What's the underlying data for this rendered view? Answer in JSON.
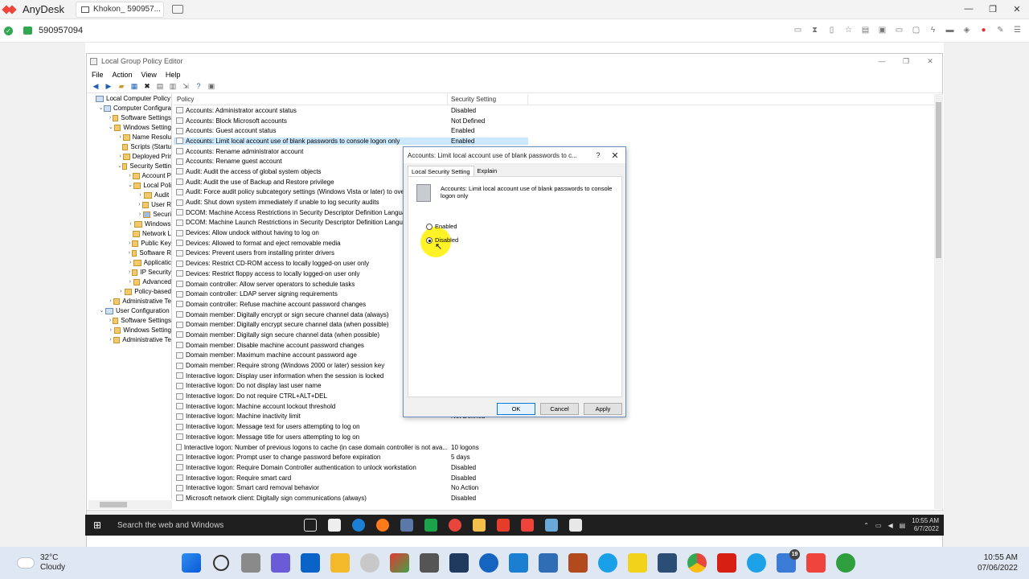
{
  "anydesk": {
    "app_name": "AnyDesk",
    "tab_label": "Khokon_ 590957...",
    "remote_id": "590957094",
    "accent": "#ef443b"
  },
  "gpe": {
    "title": "Local Group Policy Editor",
    "menu": [
      "File",
      "Action",
      "View",
      "Help"
    ],
    "tree": [
      {
        "label": "Local Computer Policy",
        "indent": 0,
        "tw": "",
        "icon": "pc"
      },
      {
        "label": "Computer Configura",
        "indent": 1,
        "tw": "⌄",
        "icon": "pc"
      },
      {
        "label": "Software Settings",
        "indent": 2,
        "tw": "›",
        "icon": "folder"
      },
      {
        "label": "Windows Setting",
        "indent": 2,
        "tw": "⌄",
        "icon": "folder"
      },
      {
        "label": "Name Resolu",
        "indent": 3,
        "tw": "›",
        "icon": "folder"
      },
      {
        "label": "Scripts (Startu",
        "indent": 3,
        "tw": "",
        "icon": "folder"
      },
      {
        "label": "Deployed Prir",
        "indent": 3,
        "tw": "›",
        "icon": "folder"
      },
      {
        "label": "Security Settin",
        "indent": 3,
        "tw": "⌄",
        "icon": "folder"
      },
      {
        "label": "Account P",
        "indent": 4,
        "tw": "›",
        "icon": "folder"
      },
      {
        "label": "Local Poli",
        "indent": 4,
        "tw": "⌄",
        "icon": "folder"
      },
      {
        "label": "Audit",
        "indent": 5,
        "tw": "›",
        "icon": "folder"
      },
      {
        "label": "User R",
        "indent": 5,
        "tw": "›",
        "icon": "folder"
      },
      {
        "label": "Securi",
        "indent": 5,
        "tw": "›",
        "icon": "folder-selected"
      },
      {
        "label": "Windows",
        "indent": 4,
        "tw": "›",
        "icon": "folder"
      },
      {
        "label": "Network L",
        "indent": 4,
        "tw": "",
        "icon": "folder"
      },
      {
        "label": "Public Key",
        "indent": 4,
        "tw": "›",
        "icon": "folder"
      },
      {
        "label": "Software R",
        "indent": 4,
        "tw": "›",
        "icon": "folder"
      },
      {
        "label": "Applicatic",
        "indent": 4,
        "tw": "›",
        "icon": "folder"
      },
      {
        "label": "IP Security",
        "indent": 4,
        "tw": "›",
        "icon": "folder"
      },
      {
        "label": "Advanced",
        "indent": 4,
        "tw": "›",
        "icon": "folder"
      },
      {
        "label": "Policy-based",
        "indent": 3,
        "tw": "›",
        "icon": "folder"
      },
      {
        "label": "Administrative Te",
        "indent": 2,
        "tw": "›",
        "icon": "folder"
      },
      {
        "label": "User Configuration",
        "indent": 1,
        "tw": "⌄",
        "icon": "pc"
      },
      {
        "label": "Software Settings",
        "indent": 2,
        "tw": "›",
        "icon": "folder"
      },
      {
        "label": "Windows Setting",
        "indent": 2,
        "tw": "›",
        "icon": "folder"
      },
      {
        "label": "Administrative Te",
        "indent": 2,
        "tw": "›",
        "icon": "folder"
      }
    ],
    "columns": {
      "policy": "Policy",
      "setting": "Security Setting"
    },
    "rows": [
      {
        "policy": "Accounts: Administrator account status",
        "setting": "Disabled"
      },
      {
        "policy": "Accounts: Block Microsoft accounts",
        "setting": "Not Defined"
      },
      {
        "policy": "Accounts: Guest account status",
        "setting": "Enabled"
      },
      {
        "policy": "Accounts: Limit local account use of blank passwords to console logon only",
        "setting": "Enabled",
        "selected": true
      },
      {
        "policy": "Accounts: Rename administrator account",
        "setting": ""
      },
      {
        "policy": "Accounts: Rename guest account",
        "setting": ""
      },
      {
        "policy": "Audit: Audit the access of global system objects",
        "setting": ""
      },
      {
        "policy": "Audit: Audit the use of Backup and Restore privilege",
        "setting": ""
      },
      {
        "policy": "Audit: Force audit policy subcategory settings (Windows Vista or later) to overr",
        "setting": ""
      },
      {
        "policy": "Audit: Shut down system immediately if unable to log security audits",
        "setting": ""
      },
      {
        "policy": "DCOM: Machine Access Restrictions in Security Descriptor Definition Languag",
        "setting": ""
      },
      {
        "policy": "DCOM: Machine Launch Restrictions in Security Descriptor Definition Langua",
        "setting": ""
      },
      {
        "policy": "Devices: Allow undock without having to log on",
        "setting": ""
      },
      {
        "policy": "Devices: Allowed to format and eject removable media",
        "setting": ""
      },
      {
        "policy": "Devices: Prevent users from installing printer drivers",
        "setting": ""
      },
      {
        "policy": "Devices: Restrict CD-ROM access to locally logged-on user only",
        "setting": ""
      },
      {
        "policy": "Devices: Restrict floppy access to locally logged-on user only",
        "setting": ""
      },
      {
        "policy": "Domain controller: Allow server operators to schedule tasks",
        "setting": ""
      },
      {
        "policy": "Domain controller: LDAP server signing requirements",
        "setting": ""
      },
      {
        "policy": "Domain controller: Refuse machine account password changes",
        "setting": ""
      },
      {
        "policy": "Domain member: Digitally encrypt or sign secure channel data (always)",
        "setting": ""
      },
      {
        "policy": "Domain member: Digitally encrypt secure channel data (when possible)",
        "setting": ""
      },
      {
        "policy": "Domain member: Digitally sign secure channel data (when possible)",
        "setting": ""
      },
      {
        "policy": "Domain member: Disable machine account password changes",
        "setting": ""
      },
      {
        "policy": "Domain member: Maximum machine account password age",
        "setting": ""
      },
      {
        "policy": "Domain member: Require strong (Windows 2000 or later) session key",
        "setting": ""
      },
      {
        "policy": "Interactive logon: Display user information when the session is locked",
        "setting": ""
      },
      {
        "policy": "Interactive logon: Do not display last user name",
        "setting": ""
      },
      {
        "policy": "Interactive logon: Do not require CTRL+ALT+DEL",
        "setting": ""
      },
      {
        "policy": "Interactive logon: Machine account lockout threshold",
        "setting": ""
      },
      {
        "policy": "Interactive logon: Machine inactivity limit",
        "setting": "Not Defined"
      },
      {
        "policy": "Interactive logon: Message text for users attempting to log on",
        "setting": ""
      },
      {
        "policy": "Interactive logon: Message title for users attempting to log on",
        "setting": ""
      },
      {
        "policy": "Interactive logon: Number of previous logons to cache (in case domain controller is not ava...",
        "setting": "10 logons"
      },
      {
        "policy": "Interactive logon: Prompt user to change password before expiration",
        "setting": "5 days"
      },
      {
        "policy": "Interactive logon: Require Domain Controller authentication to unlock workstation",
        "setting": "Disabled"
      },
      {
        "policy": "Interactive logon: Require smart card",
        "setting": "Disabled"
      },
      {
        "policy": "Interactive logon: Smart card removal behavior",
        "setting": "No Action"
      },
      {
        "policy": "Microsoft network client: Digitally sign communications (always)",
        "setting": "Disabled"
      }
    ]
  },
  "dialog": {
    "title": "Accounts: Limit local account use of blank passwords to c...",
    "help": "?",
    "tabs": [
      "Local Security Setting",
      "Explain"
    ],
    "policy_name": "Accounts: Limit local account use of blank passwords to console logon only",
    "options": [
      {
        "label": "Enabled",
        "checked": false
      },
      {
        "label": "Disabled",
        "checked": true
      }
    ],
    "ok": "OK",
    "cancel": "Cancel",
    "apply": "Apply"
  },
  "remote_taskbar": {
    "search_placeholder": "Search the web and Windows",
    "time": "10:55 AM",
    "date": "6/7/2022"
  },
  "taskbar": {
    "temp": "32°C",
    "condition": "Cloudy",
    "time": "10:55 AM",
    "date": "07/06/2022",
    "badge": "19"
  }
}
